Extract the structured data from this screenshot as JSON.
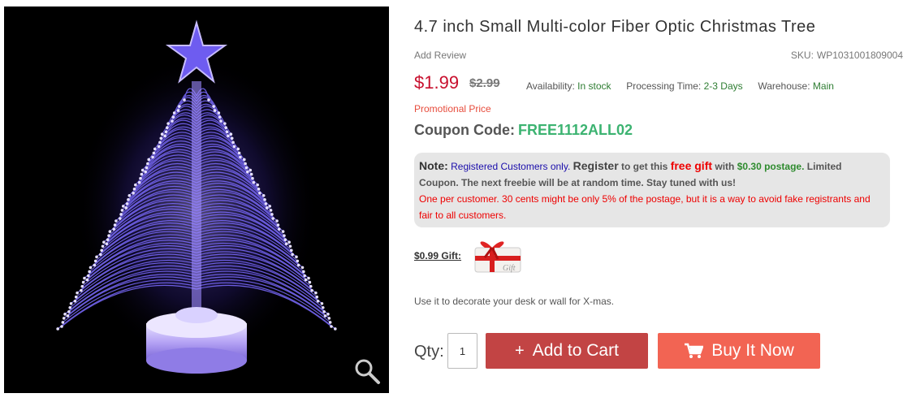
{
  "product": {
    "title": "4.7 inch Small Multi-color Fiber Optic Christmas Tree",
    "add_review": "Add Review",
    "sku_label": "SKU:",
    "sku": "WP1031001809004",
    "price": "$1.99",
    "old_price": "$2.99",
    "availability_label": "Availability:",
    "availability": "In stock",
    "processing_label": "Processing Time:",
    "processing": "2-3 Days",
    "warehouse_label": "Warehouse:",
    "warehouse": "Main",
    "promo": "Promotional Price",
    "coupon_label": "Coupon Code:",
    "coupon_code": "FREE1112ALL02",
    "description": "Use it to decorate your desk or wall for X-mas."
  },
  "note": {
    "label": "Note:",
    "registered": "Registered Customers only.",
    "register": "Register",
    "to_get": "to get this",
    "free_gift": "free gift",
    "with": "with",
    "postage": "$0.30 postage.",
    "rest": "Limited Coupon. The next freebie will be at random time. Stay tuned with us!",
    "warning": "One per customer. 30 cents might be only 5% of the postage, but it is a way to avoid fake registrants and fair to all customers."
  },
  "gift": {
    "label": "$0.99 Gift:",
    "image_text": "Gift"
  },
  "purchase": {
    "qty_label": "Qty:",
    "qty_value": "1",
    "add_to_cart": "Add to Cart",
    "add_icon": "plus-icon",
    "buy_now": "Buy It Now",
    "buy_icon": "cart-icon"
  },
  "colors": {
    "price": "#c8102e",
    "coupon": "#3cb371",
    "add_to_cart_bg": "#c24444",
    "buy_now_bg": "#f26453",
    "note_bg": "#e6e6e6"
  },
  "icons": {
    "zoom": "magnifier-icon"
  }
}
